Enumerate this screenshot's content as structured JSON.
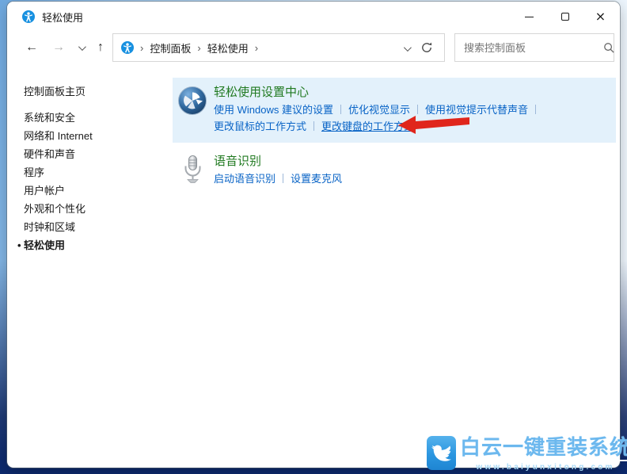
{
  "window": {
    "title": "轻松使用"
  },
  "controls": {
    "close_glyph": "×"
  },
  "toolbar": {
    "nav": {
      "back": "←",
      "forward": "→",
      "up": "↑"
    },
    "breadcrumb": {
      "sep": "›",
      "root": "控制面板",
      "current": "轻松使用"
    },
    "search_placeholder": "搜索控制面板"
  },
  "sidebar": {
    "home": "控制面板主页",
    "items": [
      "系统和安全",
      "网络和 Internet",
      "硬件和声音",
      "程序",
      "用户帐户",
      "外观和个性化",
      "时钟和区域",
      "轻松使用"
    ],
    "active_item": "轻松使用",
    "active_bullet": "•"
  },
  "main": {
    "sections": [
      {
        "title": "轻松使用设置中心",
        "row1": [
          "使用 Windows 建议的设置",
          "优化视觉显示",
          "使用视觉提示代替声音"
        ],
        "row2": [
          "更改鼠标的工作方式",
          "更改键盘的工作方式"
        ]
      },
      {
        "title": "语音识别",
        "links": [
          "启动语音识别",
          "设置麦克风"
        ]
      }
    ]
  },
  "watermark": {
    "title": "白云一键重装系统",
    "url": "www.baiyunxitong.com"
  },
  "colors": {
    "section_title_green": "#217a21",
    "link_blue": "#0863c6",
    "highlight_bg": "#e3f1fb",
    "arrow_red": "#e0261c",
    "watermark_blue": "#2b96e0"
  }
}
